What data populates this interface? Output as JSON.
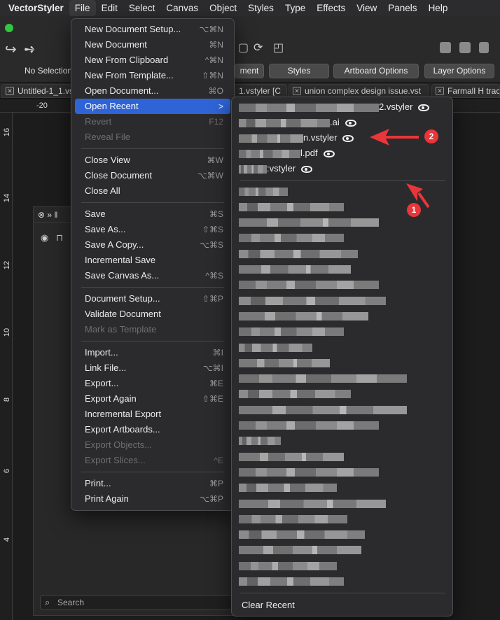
{
  "menubar": {
    "app_name": "VectorStyler",
    "items": [
      "File",
      "Edit",
      "Select",
      "Canvas",
      "Object",
      "Styles",
      "Type",
      "Effects",
      "View",
      "Panels",
      "Help"
    ]
  },
  "toolbar": {
    "selection_label": "No Selection",
    "buttons": [
      "ment",
      "Styles",
      "Artboard Options",
      "Layer Options"
    ]
  },
  "tabs": [
    "Untitled-1_1.vs",
    "1.vstyler [C",
    "union complex design issue.vst",
    "Farmall H trac"
  ],
  "ruler": {
    "top_label": "-20",
    "left_labels": [
      "16",
      "14",
      "12",
      "10",
      "8",
      "6",
      "4"
    ]
  },
  "layers_panel": {
    "search_placeholder": "Search"
  },
  "file_menu": {
    "groups": [
      [
        {
          "label": "New Document Setup...",
          "shortcut": "⌥⌘N",
          "enabled": true
        },
        {
          "label": "New Document",
          "shortcut": "⌘N",
          "enabled": true
        },
        {
          "label": "New From Clipboard",
          "shortcut": "^⌘N",
          "enabled": true
        },
        {
          "label": "New From Template...",
          "shortcut": "⇧⌘N",
          "enabled": true
        },
        {
          "label": "Open Document...",
          "shortcut": "⌘O",
          "enabled": true
        },
        {
          "label": "Open Recent",
          "shortcut": ">",
          "enabled": true,
          "highlighted": true
        },
        {
          "label": "Revert",
          "shortcut": "F12",
          "enabled": false
        },
        {
          "label": "Reveal File",
          "shortcut": "",
          "enabled": false
        }
      ],
      [
        {
          "label": "Close View",
          "shortcut": "⌘W",
          "enabled": true
        },
        {
          "label": "Close Document",
          "shortcut": "⌥⌘W",
          "enabled": true
        },
        {
          "label": "Close All",
          "shortcut": "",
          "enabled": true
        }
      ],
      [
        {
          "label": "Save",
          "shortcut": "⌘S",
          "enabled": true
        },
        {
          "label": "Save As...",
          "shortcut": "⇧⌘S",
          "enabled": true
        },
        {
          "label": "Save A Copy...",
          "shortcut": "⌥⌘S",
          "enabled": true
        },
        {
          "label": "Incremental Save",
          "shortcut": "",
          "enabled": true
        },
        {
          "label": "Save Canvas As...",
          "shortcut": "^⌘S",
          "enabled": true
        }
      ],
      [
        {
          "label": "Document Setup...",
          "shortcut": "⇧⌘P",
          "enabled": true
        },
        {
          "label": "Validate Document",
          "shortcut": "",
          "enabled": true
        },
        {
          "label": "Mark as Template",
          "shortcut": "",
          "enabled": false
        }
      ],
      [
        {
          "label": "Import...",
          "shortcut": "⌘I",
          "enabled": true
        },
        {
          "label": "Link File...",
          "shortcut": "⌥⌘I",
          "enabled": true
        },
        {
          "label": "Export...",
          "shortcut": "⌘E",
          "enabled": true
        },
        {
          "label": "Export Again",
          "shortcut": "⇧⌘E",
          "enabled": true
        },
        {
          "label": "Incremental Export",
          "shortcut": "",
          "enabled": true
        },
        {
          "label": "Export Artboards...",
          "shortcut": "",
          "enabled": true
        },
        {
          "label": "Export Objects...",
          "shortcut": "",
          "enabled": false
        },
        {
          "label": "Export Slices...",
          "shortcut": "^E",
          "enabled": false
        }
      ],
      [
        {
          "label": "Print...",
          "shortcut": "⌘P",
          "enabled": true
        },
        {
          "label": "Print Again",
          "shortcut": "⌥⌘P",
          "enabled": true
        }
      ]
    ]
  },
  "recent_menu": {
    "pinned": [
      {
        "suffix": "2.vstyler"
      },
      {
        "suffix": ".ai"
      },
      {
        "suffix": "n.vstyler"
      },
      {
        "suffix": "l.pdf"
      },
      {
        "suffix": ":vstyler"
      }
    ],
    "obscured_count": 26,
    "clear_label": "Clear Recent"
  },
  "annotations": {
    "badge_1": "1",
    "badge_2": "2",
    "color": "#e8363a"
  }
}
